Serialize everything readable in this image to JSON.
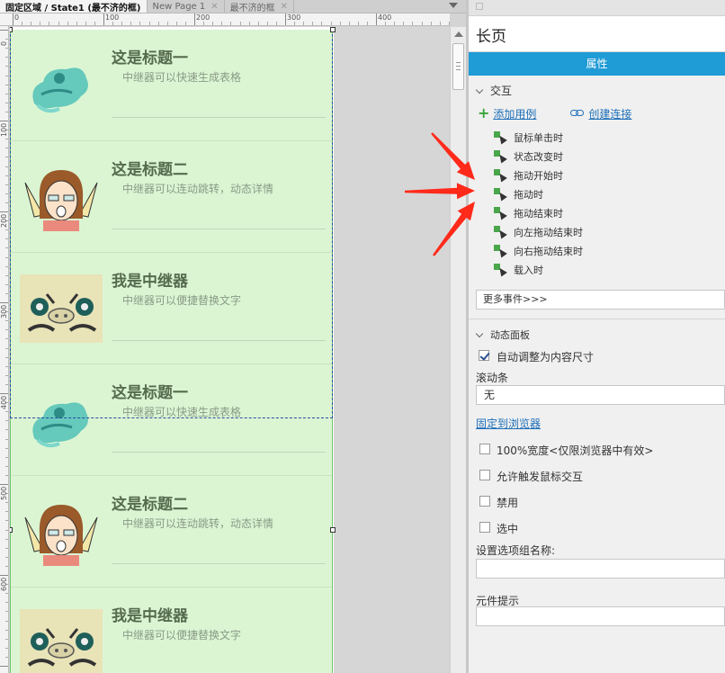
{
  "tabs": [
    {
      "label": "固定区域 / State1 (最不济的框)",
      "active": true
    },
    {
      "label": "New Page 1",
      "active": false
    },
    {
      "label": "最不济的框",
      "active": false
    }
  ],
  "ruler": {
    "top_labels": [
      "0",
      "100",
      "200",
      "300",
      "400"
    ],
    "left_labels": [
      "0",
      "100",
      "200",
      "300",
      "400",
      "500",
      "600"
    ]
  },
  "repeater_items": [
    {
      "title": "这是标题一",
      "desc": "中继器可以快速生成表格",
      "image": "blue-bird-image"
    },
    {
      "title": "这是标题二",
      "desc": "中继器可以连动跳转，动态详情",
      "image": "cartoon-girl-image"
    },
    {
      "title": "我是中继器",
      "desc": "中继器可以便捷替换文字",
      "image": "pig-face-image"
    },
    {
      "title": "这是标题一",
      "desc": "中继器可以快速生成表格",
      "image": "blue-bird-image"
    },
    {
      "title": "这是标题二",
      "desc": "中继器可以连动跳转，动态详情",
      "image": "cartoon-girl-image"
    },
    {
      "title": "我是中继器",
      "desc": "中继器可以便捷替换文字",
      "image": "pig-face-image"
    }
  ],
  "panel": {
    "title": "长页",
    "tab_label": "属性",
    "interaction": {
      "section_label": "交互",
      "add_case": "添加用例",
      "create_link": "创建连接",
      "events": [
        "鼠标单击时",
        "状态改变时",
        "拖动开始时",
        "拖动时",
        "拖动结束时",
        "向左拖动结束时",
        "向右拖动结束时",
        "载入时"
      ],
      "more_events": "更多事件>>>"
    },
    "dynamic_panel": {
      "section_label": "动态面板",
      "auto_fit_label": "自动调整为内容尺寸",
      "auto_fit_checked": true,
      "scrollbar_label": "滚动条",
      "scrollbar_value": "无",
      "pin_to_browser": "固定到浏览器",
      "options": [
        {
          "label": "100%宽度<仅限浏览器中有效>",
          "checked": false
        },
        {
          "label": "允许触发鼠标交互",
          "checked": false
        },
        {
          "label": "禁用",
          "checked": false
        },
        {
          "label": "选中",
          "checked": false
        }
      ],
      "group_name_label": "设置选项组名称:",
      "group_name_value": "",
      "tooltip_label": "元件提示",
      "tooltip_value": ""
    }
  },
  "colors": {
    "accent_tab": "#1f9bd6",
    "repeater_bg": "#dbf5d3",
    "arrow_red": "#ff2a1a"
  }
}
